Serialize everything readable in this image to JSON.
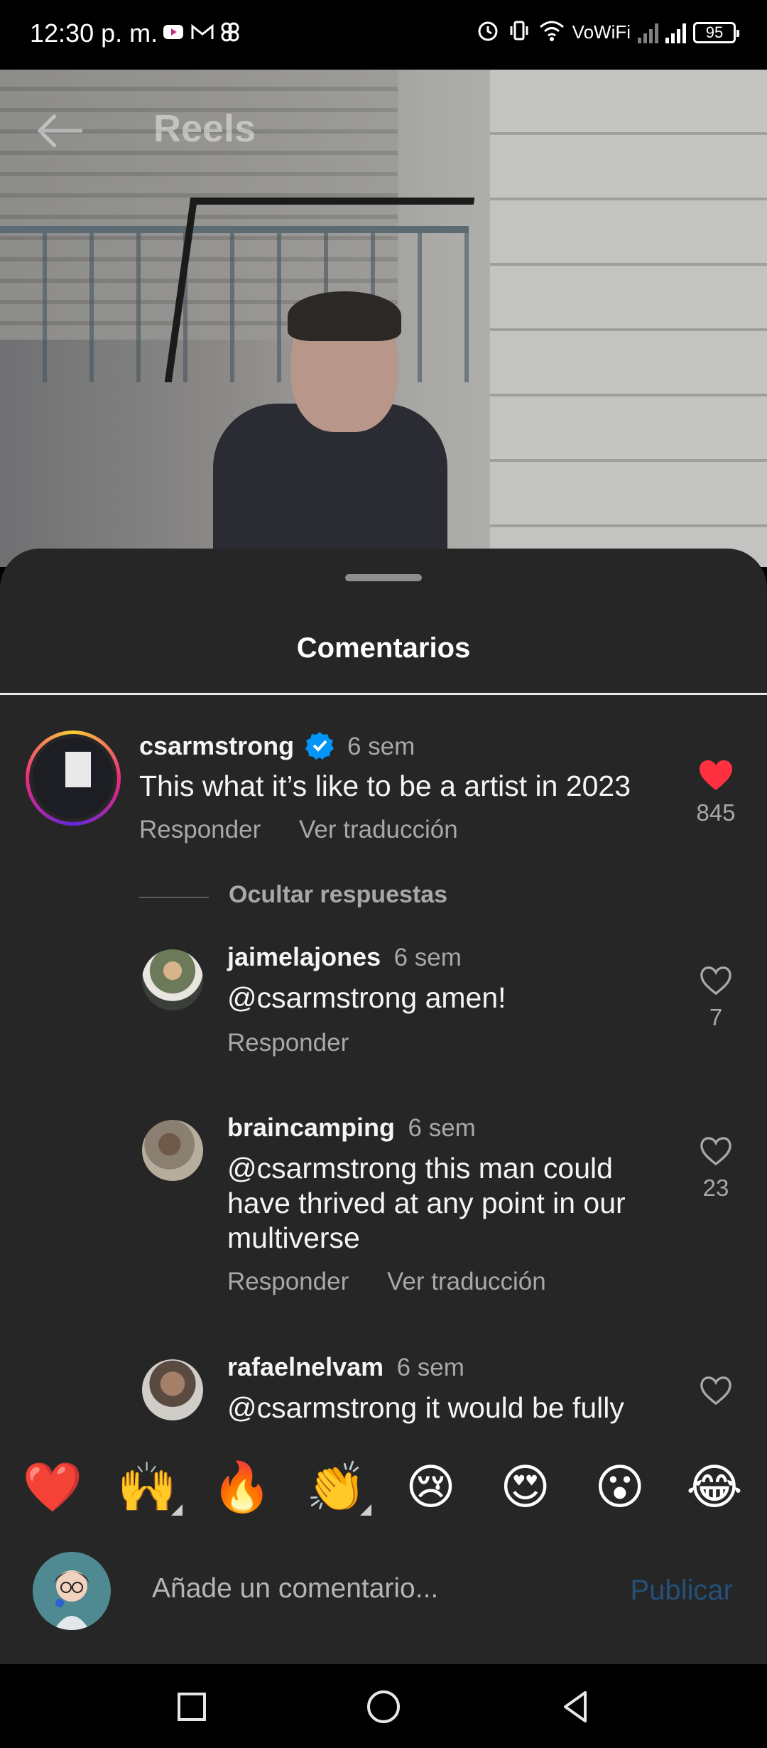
{
  "status_bar": {
    "time": "12:30 p. m.",
    "left_icons": [
      "youtube-notification-icon",
      "gmail-icon",
      "pinwheel-icon"
    ],
    "right_icons": [
      "alarm-icon",
      "vibrate-icon",
      "wifi-icon"
    ],
    "vowifi": "VoWiFi",
    "battery": "95"
  },
  "header": {
    "title": "Reels",
    "back_icon": "arrow-left-icon"
  },
  "sheet": {
    "title": "Comentarios"
  },
  "comments": [
    {
      "username": "csarmstrong",
      "verified": true,
      "time": "6 sem",
      "text": "This what it’s like to be a artist in 2023",
      "actions": [
        "Responder",
        "Ver traducción"
      ],
      "likes": "845",
      "liked": true
    }
  ],
  "hide_replies_label": "Ocultar respuestas",
  "replies": [
    {
      "username": "jaimelajones",
      "time": "6 sem",
      "mention": "@csarmstrong",
      "text": " amen!",
      "actions": [
        "Responder"
      ],
      "likes": "7"
    },
    {
      "username": "braincamping",
      "time": "6 sem",
      "mention": "@csarmstrong",
      "text": " this man could have thrived at any point in our multiverse",
      "actions": [
        "Responder",
        "Ver traducción"
      ],
      "likes": "23"
    },
    {
      "username": "rafaelnelvam",
      "time": "6 sem",
      "mention": "@csarmstrong",
      "text": " it would be fully",
      "actions": [],
      "likes": ""
    }
  ],
  "emoji_bar": [
    "❤️",
    "🙌",
    "🔥",
    "👏",
    "😢",
    "😍",
    "😮",
    "😂"
  ],
  "compose": {
    "placeholder": "Añade un comentario...",
    "publish": "Publicar"
  },
  "colors": {
    "sheet_bg": "#262626",
    "like_red": "#ff3040",
    "verified_blue": "#0095f6",
    "publish_disabled": "#24507a"
  }
}
